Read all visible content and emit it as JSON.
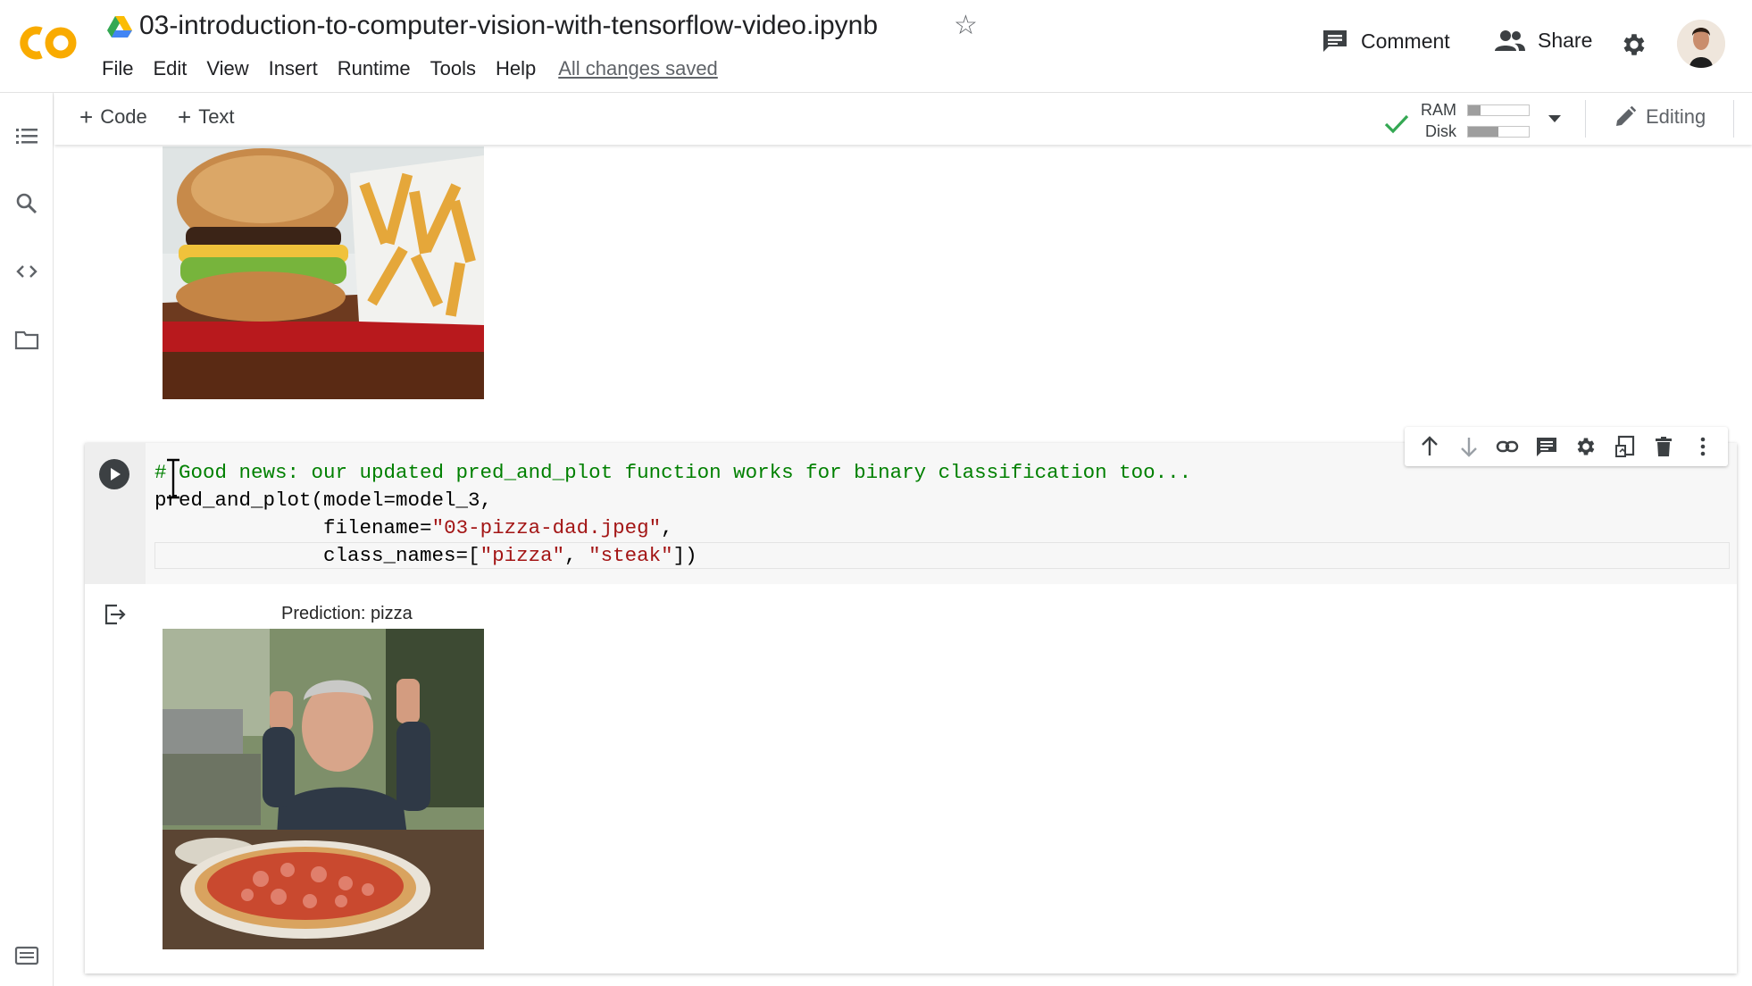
{
  "header": {
    "title": "03-introduction-to-computer-vision-with-tensorflow-video.ipynb",
    "menu": [
      "File",
      "Edit",
      "View",
      "Insert",
      "Runtime",
      "Tools",
      "Help"
    ],
    "saved_status": "All changes saved",
    "comment_label": "Comment",
    "share_label": "Share"
  },
  "toolbar": {
    "add_code_label": "Code",
    "add_text_label": "Text",
    "ram_label": "RAM",
    "disk_label": "Disk",
    "ram_usage": 0.2,
    "disk_usage": 0.5,
    "editing_label": "Editing"
  },
  "cell": {
    "code_lines": [
      {
        "tokens": [
          {
            "t": "# Good news: our updated pred_and_plot function works for binary classification too...",
            "c": "comment"
          }
        ]
      },
      {
        "tokens": [
          {
            "t": "pred_and_plot(model=model_3,",
            "c": ""
          }
        ]
      },
      {
        "tokens": [
          {
            "t": "              filename=",
            "c": ""
          },
          {
            "t": "\"03-pizza-dad.jpeg\"",
            "c": "string"
          },
          {
            "t": ",",
            "c": ""
          }
        ]
      },
      {
        "tokens": [
          {
            "t": "              class_names=[",
            "c": ""
          },
          {
            "t": "\"pizza\"",
            "c": "string"
          },
          {
            "t": ", ",
            "c": ""
          },
          {
            "t": "\"steak\"",
            "c": "string"
          },
          {
            "t": "])",
            "c": ""
          }
        ]
      }
    ],
    "output_title": "Prediction: pizza"
  },
  "colors": {
    "accent_orange": "#f9ab00",
    "comment_green": "#008000",
    "string_red": "#a31515",
    "check_green": "#34a853"
  }
}
